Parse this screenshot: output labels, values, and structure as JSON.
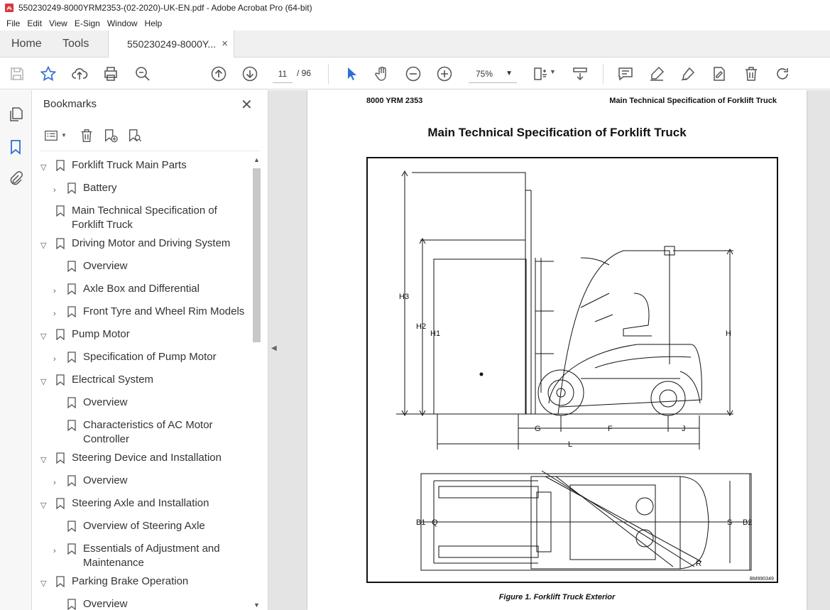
{
  "window": {
    "title": "550230249-8000YRM2353-(02-2020)-UK-EN.pdf - Adobe Acrobat Pro (64-bit)"
  },
  "menu": [
    "File",
    "Edit",
    "View",
    "E-Sign",
    "Window",
    "Help"
  ],
  "tabs": {
    "home": "Home",
    "tools": "Tools",
    "document": "550230249-8000Y...",
    "close_glyph": "×"
  },
  "toolbar": {
    "page_current": "11",
    "page_total": "/ 96",
    "zoom": "75%"
  },
  "bookmarks": {
    "title": "Bookmarks",
    "close_glyph": "✕",
    "items": [
      {
        "label": "Forklift Truck Main Parts",
        "level": 0,
        "toggle": "expanded"
      },
      {
        "label": "Battery",
        "level": 1,
        "toggle": "collapsed"
      },
      {
        "label": "Main Technical Specification of Forklift Truck",
        "level": 0,
        "toggle": "none"
      },
      {
        "label": "Driving Motor and Driving System",
        "level": 0,
        "toggle": "expanded"
      },
      {
        "label": "Overview",
        "level": 1,
        "toggle": "none"
      },
      {
        "label": "Axle Box and Differential",
        "level": 1,
        "toggle": "collapsed"
      },
      {
        "label": "Front Tyre and Wheel Rim Models",
        "level": 1,
        "toggle": "collapsed"
      },
      {
        "label": "Pump Motor",
        "level": 0,
        "toggle": "expanded"
      },
      {
        "label": "Specification of Pump Motor",
        "level": 1,
        "toggle": "collapsed"
      },
      {
        "label": "Electrical System",
        "level": 0,
        "toggle": "expanded"
      },
      {
        "label": "Overview",
        "level": 1,
        "toggle": "none"
      },
      {
        "label": "Characteristics of AC Motor Controller",
        "level": 1,
        "toggle": "none"
      },
      {
        "label": "Steering Device and Installation",
        "level": 0,
        "toggle": "expanded"
      },
      {
        "label": "Overview",
        "level": 1,
        "toggle": "collapsed"
      },
      {
        "label": "Steering Axle and Installation",
        "level": 0,
        "toggle": "expanded"
      },
      {
        "label": "Overview of Steering Axle",
        "level": 1,
        "toggle": "none"
      },
      {
        "label": "Essentials of Adjustment and Maintenance",
        "level": 1,
        "toggle": "collapsed"
      },
      {
        "label": "Parking Brake Operation",
        "level": 0,
        "toggle": "expanded"
      },
      {
        "label": "Overview",
        "level": 1,
        "toggle": "none"
      }
    ]
  },
  "document": {
    "header_left": "8000 YRM 2353",
    "header_right": "Main Technical Specification of Forklift Truck",
    "heading": "Main Technical Specification of Forklift Truck",
    "figure_labels": {
      "H3": "H3",
      "H2": "H2",
      "H1": "H1",
      "H": "H",
      "G": "G",
      "F": "F",
      "J": "J",
      "L": "L",
      "B1": "B1",
      "Q": "Q",
      "S": "S",
      "B2": "B2",
      "R": "R",
      "code": "BM990349"
    },
    "caption": "Figure 1. Forklift Truck Exterior"
  }
}
